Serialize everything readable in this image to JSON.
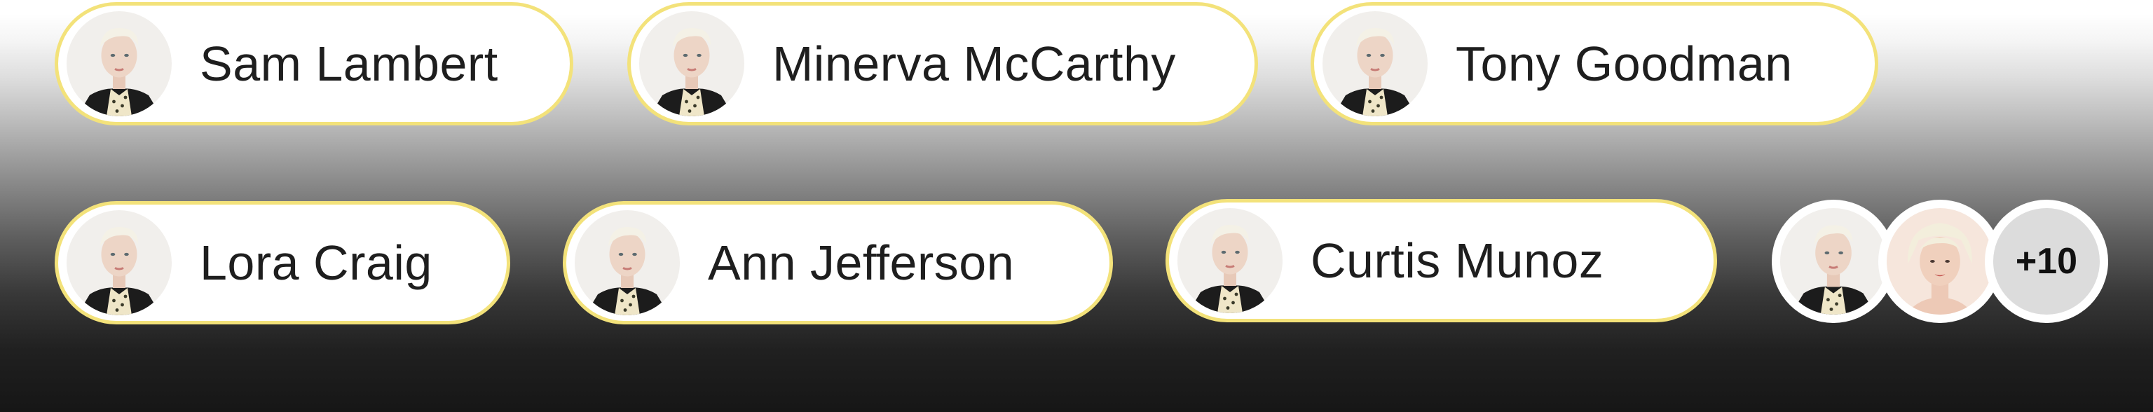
{
  "chips": [
    {
      "name": "Sam Lambert"
    },
    {
      "name": "Minerva McCarthy"
    },
    {
      "name": "Tony Goodman"
    },
    {
      "name": "Lora Craig"
    },
    {
      "name": "Ann Jefferson"
    },
    {
      "name": "Curtis Munoz"
    }
  ],
  "avatar_group": {
    "overflow_label": "+10"
  },
  "colors": {
    "chip_border": "#f3e27a",
    "chip_background": "#ffffff",
    "text": "#1e1e1e",
    "overflow_background": "#dcdcdc"
  }
}
